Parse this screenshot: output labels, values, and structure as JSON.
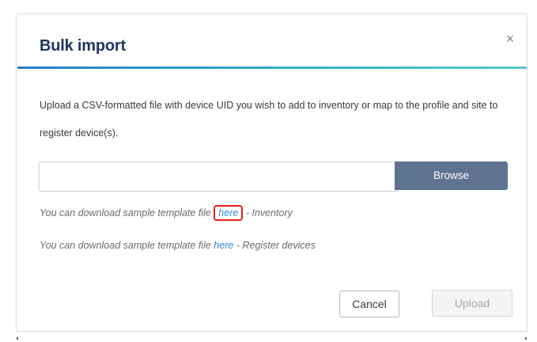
{
  "dialog": {
    "title": "Bulk import",
    "close_glyph": "×",
    "close_icon": "close-icon",
    "accent_gradient": [
      "#2a7ec6",
      "#2fb5c9",
      "#59c7cf"
    ],
    "title_color": "#1f3660"
  },
  "description": "Upload a CSV-formatted file with device UID you wish to add to inventory or map to the profile and site to register device(s).",
  "file_picker": {
    "value": "",
    "placeholder": "",
    "browse_label": "Browse",
    "browse_color": "#5f7391"
  },
  "templates": [
    {
      "prefix": "You can download sample template file",
      "link_label": "here",
      "separator": "-",
      "suffix": "Inventory",
      "highlighted": true
    },
    {
      "prefix": "You can download sample template file",
      "link_label": "here",
      "separator": "-",
      "suffix": "Register devices",
      "highlighted": false
    }
  ],
  "link_color": "#2f8bd3",
  "highlight_color": "#e31d1d",
  "footer": {
    "cancel_label": "Cancel",
    "upload_label": "Upload",
    "upload_enabled": false
  }
}
